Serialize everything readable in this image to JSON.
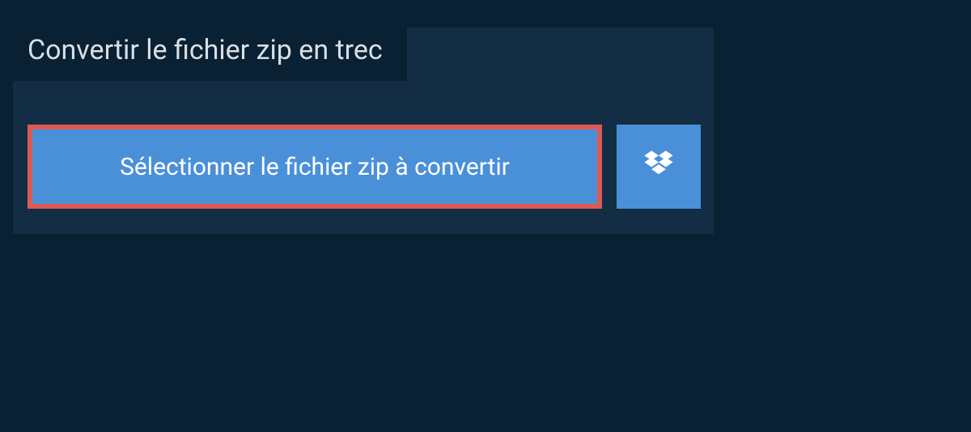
{
  "title": "Convertir le fichier zip en trec",
  "select_button_label": "Sélectionner le fichier zip à convertir",
  "colors": {
    "background": "#0a2133",
    "panel": "#132d44",
    "button": "#4a90d9",
    "highlight_border": "#dd5a52",
    "title_text": "#d8dfe6"
  }
}
